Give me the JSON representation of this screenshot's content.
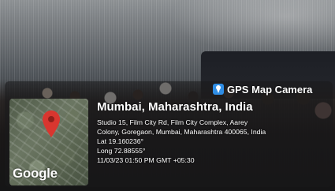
{
  "badge": {
    "label": "GPS Map Camera",
    "icon": "location-pin-icon",
    "icon_color": "#2f8ee6"
  },
  "map": {
    "logo": "Google",
    "pin_icon": "map-pin-icon",
    "pin_color": "#d9362f"
  },
  "location": {
    "title": "Mumbai, Maharashtra, India",
    "address_line_1": "Studio 15, Film City Rd, Film City Complex, Aarey",
    "address_line_2": "Colony, Goregaon, Mumbai, Maharashtra 400065, India",
    "lat": "Lat 19.160236°",
    "long": "Long 72.88555°",
    "timestamp": "11/03/23 01:50 PM GMT +05:30"
  }
}
